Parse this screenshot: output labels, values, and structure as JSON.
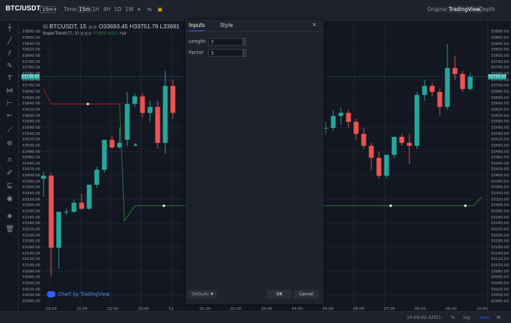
{
  "topbar": {
    "pair": "BTC/USDT",
    "interval_box": "15m",
    "time_label": "Time",
    "timeframes": [
      "15m",
      "1H",
      "4H",
      "1D",
      "1W"
    ],
    "active_timeframe": "15m",
    "views": [
      "Original",
      "TradingView",
      "Depth"
    ],
    "active_view": "TradingView"
  },
  "legend": {
    "symbol": "BTCUSDT, 15",
    "open": "O33693.45",
    "high": "H33751.79",
    "low": "L33691",
    "indicator": "SuperTrend (7, 3)",
    "indicator_value": "33962.6321",
    "indicator_na": "n/a"
  },
  "y_axis": {
    "labels": [
      "33880.00",
      "33860.00",
      "33840.00",
      "33820.00",
      "33800.00",
      "33780.00",
      "33760.00",
      "33740.00",
      "33720.00",
      "33700.00",
      "33680.00",
      "33660.00",
      "33640.00",
      "33620.00",
      "33600.00",
      "33580.00",
      "33560.00",
      "33540.00",
      "33520.00",
      "33500.00",
      "33480.00",
      "33460.00",
      "33440.00",
      "33420.00",
      "33400.00",
      "33380.00",
      "33360.00",
      "33340.00",
      "33320.00",
      "33300.00",
      "33280.00",
      "33260.00",
      "33240.00",
      "33220.00",
      "33200.00",
      "33180.00",
      "33160.00",
      "33140.00",
      "33120.00",
      "33100.00",
      "33080.00",
      "33060.00",
      "33040.00",
      "33020.00",
      "33000.00",
      "32980.00"
    ],
    "left_labels": [
      "33880.00",
      "33860.00",
      "33840.00",
      "33820.00",
      "33800.00",
      "33780.00",
      "33760.00",
      "33740.00",
      "33720.00",
      "33700.00",
      "33680.00",
      "33660.00",
      "33640.00",
      "33620.00",
      "33600.00",
      "33580.00",
      "33560.00",
      "33540.00",
      "33520.00",
      "33500.00",
      "33480.00",
      "33460.00",
      "33440.00",
      "33420.00",
      "33400.00",
      "33380.00",
      "33360.00",
      "33340.00",
      "33320.00",
      "33300.00",
      "33280.00",
      "33260.00",
      "33240.00",
      "33220.00",
      "33200.00",
      "33180.00",
      "33160.00",
      "33140.00",
      "33120.00",
      "33100.00",
      "33080.00",
      "33060.00",
      "33040.00",
      "33020.00",
      "33000.00",
      "32980.00"
    ],
    "current_price": "33730.93"
  },
  "x_axis": {
    "labels": [
      "20:00",
      "21:00",
      "22:00",
      "23:00",
      "11",
      "01:00",
      "02:00",
      "03:00",
      "04:00",
      "05:00",
      "06:00",
      "07:00",
      "08:00",
      "09:00",
      "10:00"
    ]
  },
  "watermark": "Chart by TradingView",
  "dialog": {
    "tabs": [
      "Inputs",
      "Style"
    ],
    "active_tab": "Inputs",
    "close": "×",
    "length_label": "Length",
    "length_value": "7",
    "factor_label": "Factor",
    "factor_value": "3",
    "defaults_label": "Defaults ▼",
    "ok_label": "OK",
    "cancel_label": "Cancel"
  },
  "bottombar": {
    "time": "10:09:02 (UTC)",
    "pct": "%",
    "log": "log",
    "auto": "auto"
  },
  "colors": {
    "up": "#26a69a",
    "down": "#ef5350",
    "supertrend_up": "#2e7d32",
    "supertrend_down": "#b71c1c",
    "background": "#131722"
  },
  "chart_data": {
    "type": "candlestick",
    "ylim": [
      32980,
      33890
    ],
    "candles": [
      {
        "o": 33400,
        "h": 33415,
        "l": 33330,
        "c": 33390,
        "dir": "up"
      },
      {
        "o": 33400,
        "h": 33410,
        "l": 33065,
        "c": 33160,
        "dir": "down"
      },
      {
        "o": 33160,
        "h": 33280,
        "l": 33090,
        "c": 33280,
        "dir": "up"
      },
      {
        "o": 33280,
        "h": 33290,
        "l": 33270,
        "c": 33280,
        "dir": "flat"
      },
      {
        "o": 33280,
        "h": 33320,
        "l": 33275,
        "c": 33310,
        "dir": "up"
      },
      {
        "o": 33310,
        "h": 33340,
        "l": 33285,
        "c": 33290,
        "dir": "down"
      },
      {
        "o": 33290,
        "h": 33370,
        "l": 33285,
        "c": 33370,
        "dir": "up"
      },
      {
        "o": 33370,
        "h": 33430,
        "l": 33360,
        "c": 33420,
        "dir": "up"
      },
      {
        "o": 33420,
        "h": 33520,
        "l": 33410,
        "c": 33520,
        "dir": "up"
      },
      {
        "o": 33520,
        "h": 33535,
        "l": 33490,
        "c": 33495,
        "dir": "down"
      },
      {
        "o": 33495,
        "h": 33560,
        "l": 33490,
        "c": 33510,
        "dir": "up"
      },
      {
        "o": 33520,
        "h": 33680,
        "l": 33500,
        "c": 33640,
        "dir": "up"
      },
      {
        "o": 33640,
        "h": 33675,
        "l": 33630,
        "c": 33665,
        "dir": "up"
      },
      {
        "o": 33665,
        "h": 33675,
        "l": 33595,
        "c": 33610,
        "dir": "down"
      },
      {
        "o": 33610,
        "h": 33650,
        "l": 33580,
        "c": 33630,
        "dir": "up"
      },
      {
        "o": 33630,
        "h": 33650,
        "l": 33490,
        "c": 33510,
        "dir": "down"
      },
      {
        "o": 33510,
        "h": 33750,
        "l": 33475,
        "c": 33700,
        "dir": "up"
      },
      {
        "o": 33700,
        "h": 33720,
        "l": 33590,
        "c": 33610,
        "dir": "down"
      },
      {
        "o": 33560,
        "h": 33580,
        "l": 33540,
        "c": 33560,
        "dir": "up"
      },
      {
        "o": 33560,
        "h": 33620,
        "l": 33550,
        "c": 33600,
        "dir": "up"
      },
      {
        "o": 33600,
        "h": 33630,
        "l": 33570,
        "c": 33610,
        "dir": "up"
      },
      {
        "o": 33610,
        "h": 33620,
        "l": 33560,
        "c": 33580,
        "dir": "down"
      },
      {
        "o": 33580,
        "h": 33590,
        "l": 33520,
        "c": 33540,
        "dir": "down"
      },
      {
        "o": 33540,
        "h": 33560,
        "l": 33490,
        "c": 33500,
        "dir": "down"
      },
      {
        "o": 33500,
        "h": 33510,
        "l": 33420,
        "c": 33460,
        "dir": "down"
      },
      {
        "o": 33460,
        "h": 33480,
        "l": 33390,
        "c": 33400,
        "dir": "down"
      },
      {
        "o": 33400,
        "h": 33470,
        "l": 33390,
        "c": 33470,
        "dir": "up"
      },
      {
        "o": 33470,
        "h": 33530,
        "l": 33460,
        "c": 33530,
        "dir": "up"
      },
      {
        "o": 33530,
        "h": 33540,
        "l": 33500,
        "c": 33510,
        "dir": "down"
      },
      {
        "o": 33510,
        "h": 33540,
        "l": 33440,
        "c": 33500,
        "dir": "down"
      },
      {
        "o": 33500,
        "h": 33680,
        "l": 33490,
        "c": 33670,
        "dir": "up"
      },
      {
        "o": 33670,
        "h": 33720,
        "l": 33650,
        "c": 33700,
        "dir": "up"
      },
      {
        "o": 33700,
        "h": 33710,
        "l": 33665,
        "c": 33680,
        "dir": "down"
      },
      {
        "o": 33680,
        "h": 33690,
        "l": 33600,
        "c": 33630,
        "dir": "down"
      },
      {
        "o": 33630,
        "h": 33840,
        "l": 33620,
        "c": 33760,
        "dir": "up"
      },
      {
        "o": 33760,
        "h": 33800,
        "l": 33720,
        "c": 33740,
        "dir": "down"
      },
      {
        "o": 33740,
        "h": 33750,
        "l": 33680,
        "c": 33690,
        "dir": "down"
      },
      {
        "o": 33690,
        "h": 33745,
        "l": 33685,
        "c": 33731,
        "dir": "up"
      }
    ],
    "supertrend_segments": [
      {
        "trend": "down",
        "values": [
          33690,
          33640,
          33640,
          33640,
          33640,
          33640,
          33640,
          33640,
          33640,
          33640,
          33640
        ]
      },
      {
        "trend": "up",
        "values": [
          33640,
          33250,
          33300,
          33300
        ]
      }
    ]
  }
}
